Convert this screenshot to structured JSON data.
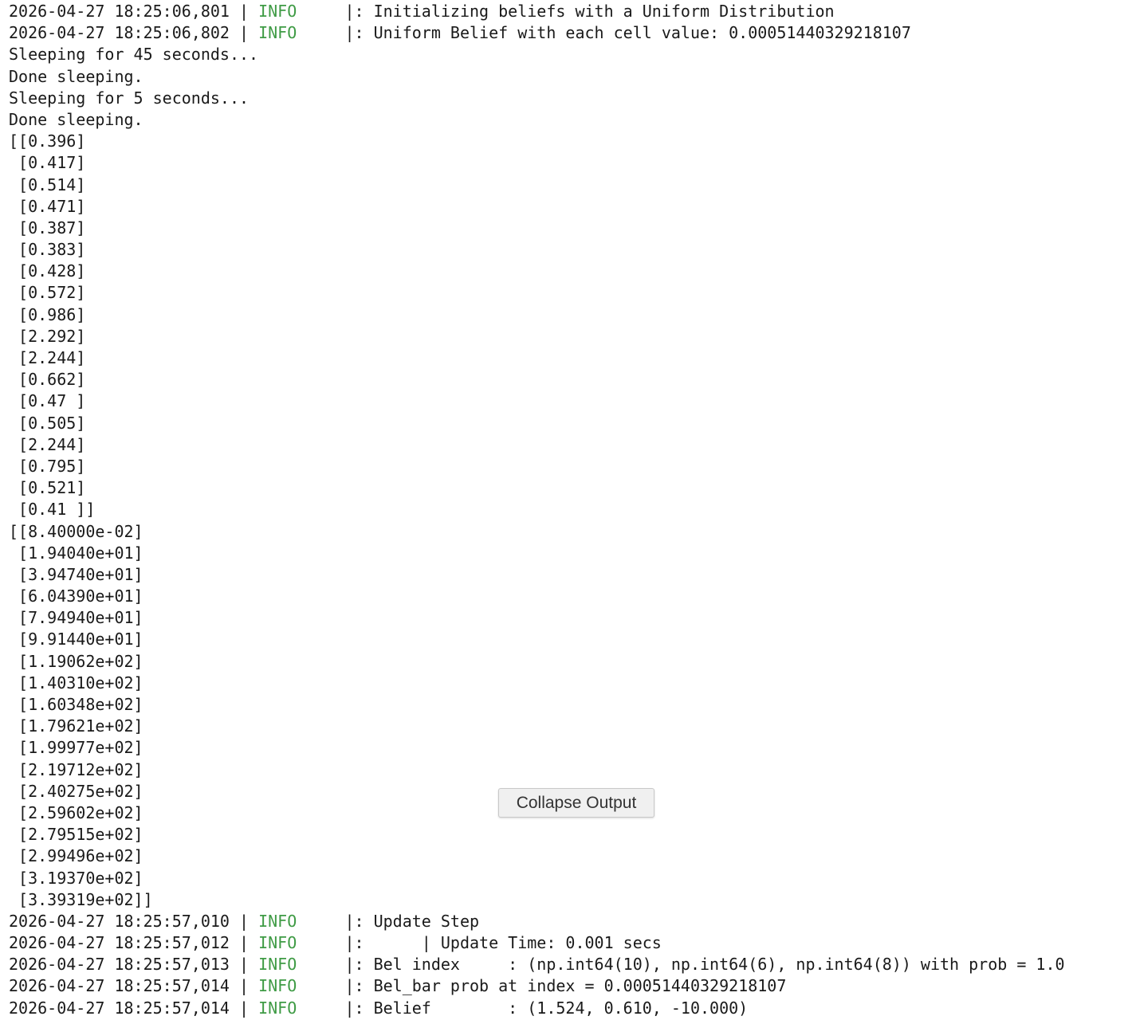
{
  "output": {
    "header_logs": [
      {
        "timestamp": "2026-04-27 18:25:06,801",
        "level": "INFO",
        "message": "|: Initializing beliefs with a Uniform Distribution"
      },
      {
        "timestamp": "2026-04-27 18:25:06,802",
        "level": "INFO",
        "message": "|: Uniform Belief with each cell value: 0.00051440329218107"
      }
    ],
    "plain_lines": [
      "Sleeping for 45 seconds...",
      "Done sleeping.",
      "Sleeping for 5 seconds...",
      "Done sleeping."
    ],
    "array1": [
      "[[0.396]",
      " [0.417]",
      " [0.514]",
      " [0.471]",
      " [0.387]",
      " [0.383]",
      " [0.428]",
      " [0.572]",
      " [0.986]",
      " [2.292]",
      " [2.244]",
      " [0.662]",
      " [0.47 ]",
      " [0.505]",
      " [2.244]",
      " [0.795]",
      " [0.521]",
      " [0.41 ]]"
    ],
    "array2": [
      "[[8.40000e-02]",
      " [1.94040e+01]",
      " [3.94740e+01]",
      " [6.04390e+01]",
      " [7.94940e+01]",
      " [9.91440e+01]",
      " [1.19062e+02]",
      " [1.40310e+02]",
      " [1.60348e+02]",
      " [1.79621e+02]",
      " [1.99977e+02]",
      " [2.19712e+02]",
      " [2.40275e+02]",
      " [2.59602e+02]",
      " [2.79515e+02]",
      " [2.99496e+02]",
      " [3.19370e+02]",
      " [3.39319e+02]]"
    ],
    "footer_logs": [
      {
        "timestamp": "2026-04-27 18:25:57,010",
        "level": "INFO",
        "message": "|: Update Step"
      },
      {
        "timestamp": "2026-04-27 18:25:57,012",
        "level": "INFO",
        "message": "|:      | Update Time: 0.001 secs"
      },
      {
        "timestamp": "2026-04-27 18:25:57,013",
        "level": "INFO",
        "message": "|: Bel index     : (np.int64(10), np.int64(6), np.int64(8)) with prob = 1.0"
      },
      {
        "timestamp": "2026-04-27 18:25:57,014",
        "level": "INFO",
        "message": "|: Bel_bar prob at index = 0.00051440329218107"
      },
      {
        "timestamp": "2026-04-27 18:25:57,014",
        "level": "INFO",
        "message": "|: Belief        : (1.524, 0.610, -10.000)"
      }
    ],
    "separator": " | ",
    "level_padding": "     "
  },
  "collapse_button": {
    "label": "Collapse Output"
  },
  "colors": {
    "text": "#1a1a1a",
    "log_level": "#3f9b45",
    "background": "#ffffff"
  }
}
